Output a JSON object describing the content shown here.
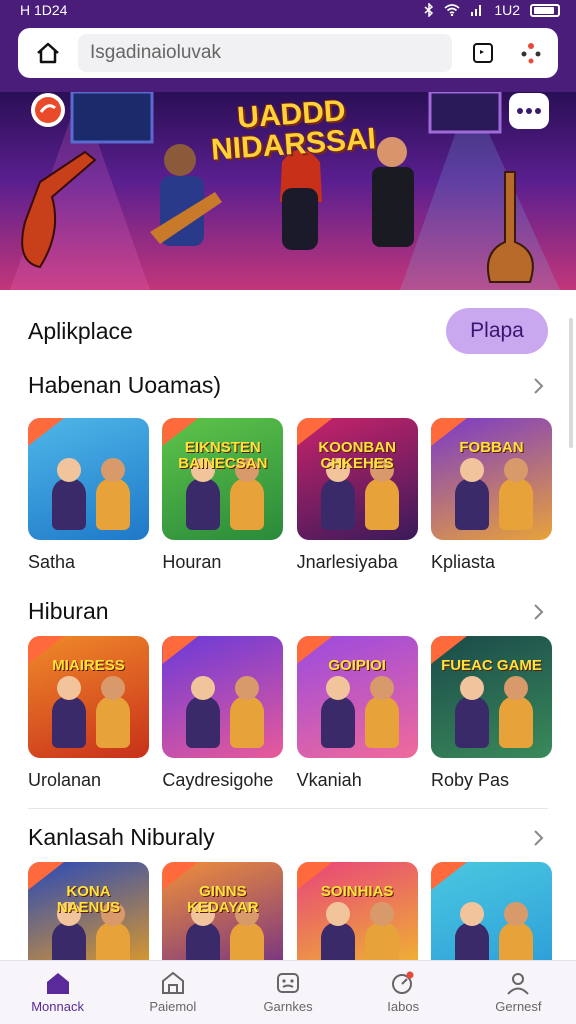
{
  "status": {
    "time": "H 1D24",
    "right_text": "1U2"
  },
  "browser": {
    "url": "Isgadinaioluvak"
  },
  "banner": {
    "title": "UADDD NIDARSSAI"
  },
  "section_featured": {
    "title": "Aplikplace",
    "button_label": "Plapa"
  },
  "sections": [
    {
      "title": "Habenan Uoamas)",
      "items": [
        {
          "label": "Satha",
          "thumb_text": "",
          "colors": [
            "#4fb7e8",
            "#1e78c8"
          ]
        },
        {
          "label": "Houran",
          "thumb_text": "EIKNSTEN BAINECSAN",
          "colors": [
            "#5ec44a",
            "#2a8a3a"
          ]
        },
        {
          "label": "Jnarlesiyaba",
          "thumb_text": "KOONBAN CHKEHES",
          "colors": [
            "#c8236a",
            "#3a1a5a"
          ]
        },
        {
          "label": "Kpliasta",
          "thumb_text": "FOBBAN",
          "colors": [
            "#7a3ac8",
            "#e8a23a"
          ]
        }
      ]
    },
    {
      "title": "Hiburan",
      "items": [
        {
          "label": "Urolanan",
          "thumb_text": "MIAIRESS",
          "colors": [
            "#f08a2a",
            "#c8301a"
          ]
        },
        {
          "label": "Caydresigohe",
          "thumb_text": "",
          "colors": [
            "#6a3ad8",
            "#e85a9a"
          ]
        },
        {
          "label": "Vkaniah",
          "thumb_text": "GOIPIOI",
          "colors": [
            "#9a4ae0",
            "#f06a9a"
          ]
        },
        {
          "label": "Roby Pas",
          "thumb_text": "FUEAC GAME",
          "colors": [
            "#1a4a4a",
            "#3a8a5a"
          ]
        }
      ]
    },
    {
      "title": "Kanlasah Niburaly",
      "items": [
        {
          "label": "",
          "thumb_text": "KONA NAENUS",
          "colors": [
            "#2a4ab8",
            "#f0a21a"
          ]
        },
        {
          "label": "",
          "thumb_text": "GINNS KEDAYAR",
          "colors": [
            "#f0903a",
            "#6a2a8a"
          ]
        },
        {
          "label": "",
          "thumb_text": "SOINHIAS",
          "colors": [
            "#e8447a",
            "#f0c02a"
          ]
        },
        {
          "label": "",
          "thumb_text": "",
          "colors": [
            "#4ac8e0",
            "#2a9ad8"
          ]
        }
      ]
    }
  ],
  "nav": [
    {
      "label": "Monnack",
      "icon": "home-icon",
      "active": true
    },
    {
      "label": "Paiemol",
      "icon": "store-icon",
      "active": false
    },
    {
      "label": "Garnkes",
      "icon": "games-icon",
      "active": false
    },
    {
      "label": "Iabos",
      "icon": "apps-icon",
      "active": false
    },
    {
      "label": "Gernesf",
      "icon": "profile-icon",
      "active": false
    }
  ],
  "theme": {
    "accent": "#4a1d7a",
    "button_bg": "#c9a8f0"
  }
}
